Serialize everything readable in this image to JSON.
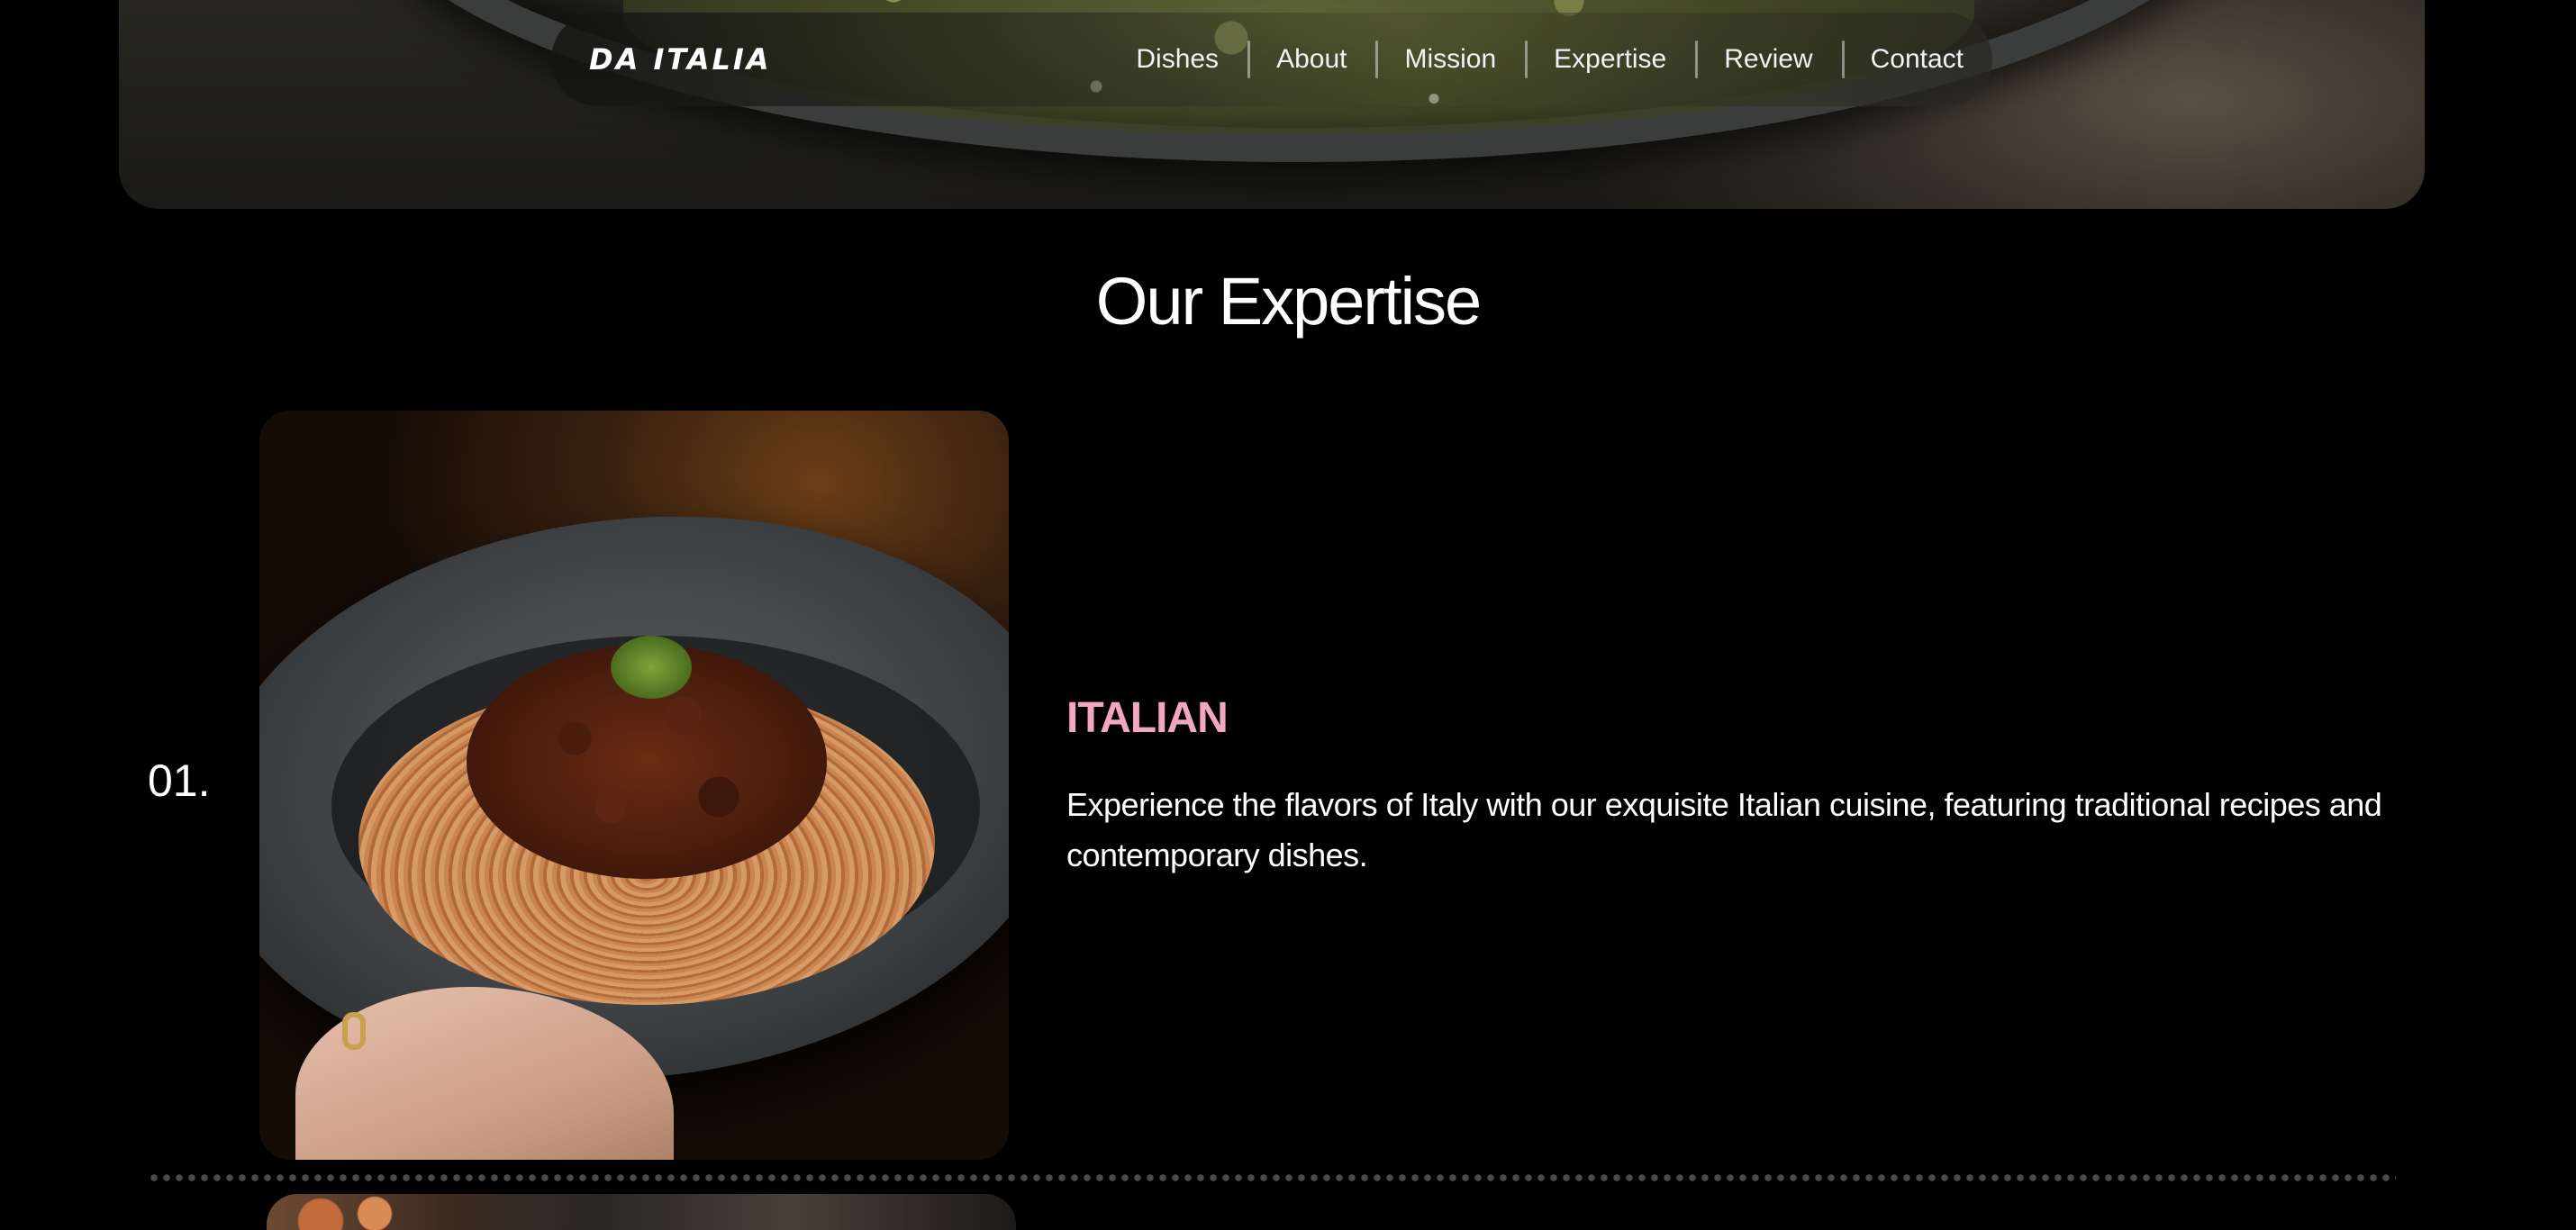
{
  "nav": {
    "logo": "DA ITALIA",
    "items": [
      {
        "label": "Dishes"
      },
      {
        "label": "About"
      },
      {
        "label": "Mission"
      },
      {
        "label": "Expertise"
      },
      {
        "label": "Review"
      },
      {
        "label": "Contact"
      }
    ]
  },
  "section": {
    "title": "Our Expertise"
  },
  "expertise": [
    {
      "index": "01.",
      "heading": "ITALIAN",
      "description": "Experience the flavors of Italy with our exquisite Italian cuisine, featuring traditional recipes and contemporary dishes."
    }
  ],
  "colors": {
    "background": "#000000",
    "accent_heading": "#f2a7bf",
    "text": "#ffffff"
  }
}
